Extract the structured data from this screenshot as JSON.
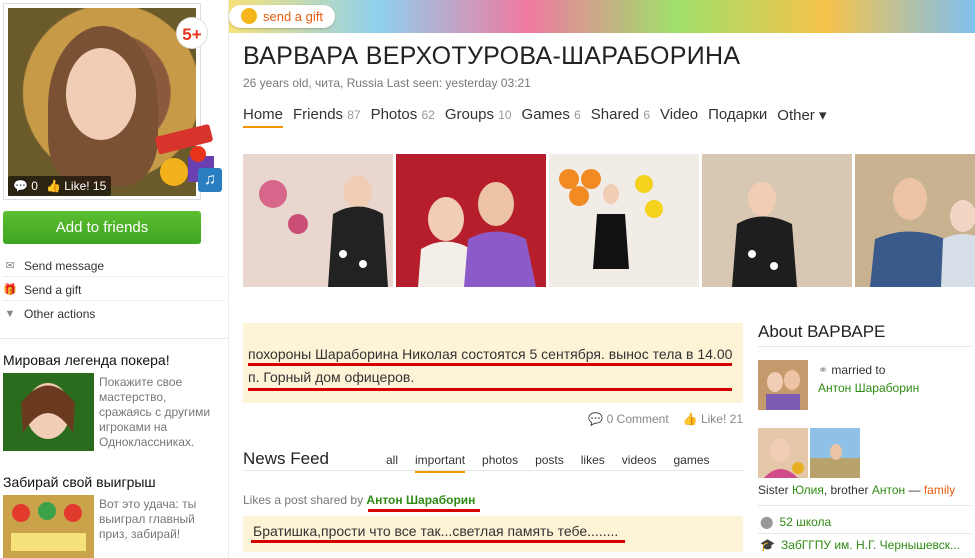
{
  "profile": {
    "name": "ВАРВАРА ВЕРХОТУРОВА-ШАРАБОРИНА",
    "meta": "26 years old, чита, Russia  Last seen: yesterday 03:21",
    "age_badge": "5+",
    "comments_count": "0",
    "likes_label": "Like! 15"
  },
  "banner": {
    "send_gift": "send a gift"
  },
  "left_actions": {
    "add_friends": "Add to friends",
    "send_message": "Send message",
    "send_gift": "Send a gift",
    "other_actions": "Other actions"
  },
  "ads": [
    {
      "title": "Мировая легенда покера!",
      "text": "Покажите свое мастерство, сражаясь с другими игроками на Одноклассниках."
    },
    {
      "title": "Забирай свой выигрыш",
      "text": "Вот это удача: ты выиграл главный приз, забирай!"
    }
  ],
  "tabs": [
    {
      "label": "Home",
      "count": ""
    },
    {
      "label": "Friends",
      "count": "87"
    },
    {
      "label": "Photos",
      "count": "62"
    },
    {
      "label": "Groups",
      "count": "10"
    },
    {
      "label": "Games",
      "count": "6"
    },
    {
      "label": "Shared",
      "count": "6"
    },
    {
      "label": "Video",
      "count": ""
    },
    {
      "label": "Подарки",
      "count": ""
    },
    {
      "label": "Other ▾",
      "count": ""
    }
  ],
  "status": {
    "text": "похороны Шараборина Николая состоятся 5 сентября. вынос тела в 14.00 п. Горный дом офицеров.",
    "comments": "0 Comment",
    "likes": "Like! 21"
  },
  "feed": {
    "title": "News Feed",
    "tabs": [
      "all",
      "important",
      "photos",
      "posts",
      "likes",
      "videos",
      "games"
    ],
    "likes_prefix": "Likes a post shared by",
    "likes_user": "Антон Шараборин",
    "post_text": "Братишка,прости что все так...светлая память тебе........"
  },
  "about": {
    "title": "About ВАРВАРЕ",
    "married_label": "married to",
    "married_name": "Антон Шараборин",
    "relatives_prefix": "Sister",
    "sister": "Юлия",
    "brother_label": "brother",
    "brother": "Антон",
    "family_link": "family",
    "school": "52 школа",
    "university": "ЗабГГПУ им. Н.Г. Чернышевск..."
  },
  "colors": {
    "accent": "#f39600",
    "green": "#2f8a13",
    "highlight_bg": "#fdf3d6",
    "underline_red": "#d40000"
  }
}
